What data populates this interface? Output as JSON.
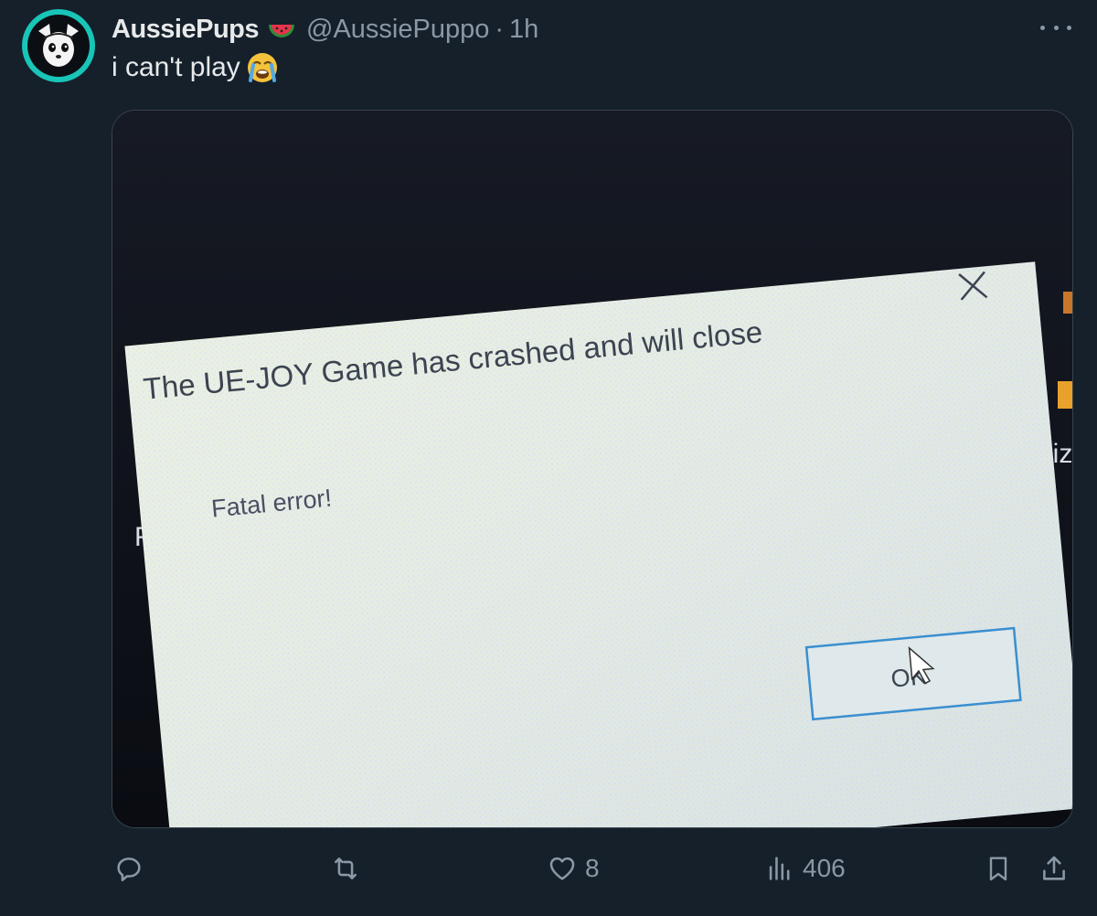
{
  "post": {
    "display_name": "AussiePups",
    "handle": "@AussiePuppo",
    "separator": "·",
    "time": "1h",
    "name_emoji": "watermelon-icon",
    "text": "i can't play",
    "text_emoji": "loudly-crying-face-icon"
  },
  "media": {
    "dialog_title": "The UE-JOY Game has crashed and will close",
    "dialog_message": "Fatal error!",
    "ok_label": "OK",
    "bg_fragment_right": "biz",
    "bg_fragment_left": "F"
  },
  "actions": {
    "reply": {
      "icon": "reply-icon",
      "count": ""
    },
    "repost": {
      "icon": "repost-icon",
      "count": ""
    },
    "like": {
      "icon": "heart-icon",
      "count": "8"
    },
    "views": {
      "icon": "views-chart-icon",
      "count": "406"
    },
    "bookmark": {
      "icon": "bookmark-icon"
    },
    "share": {
      "icon": "share-icon"
    }
  },
  "colors": {
    "background": "#15202b",
    "text_primary": "#e7e9ea",
    "text_secondary": "#8b98a5",
    "avatar_ring": "#19c4b8",
    "dialog_bg": "#e4ece6",
    "dialog_button_border": "#3a8fd0"
  }
}
